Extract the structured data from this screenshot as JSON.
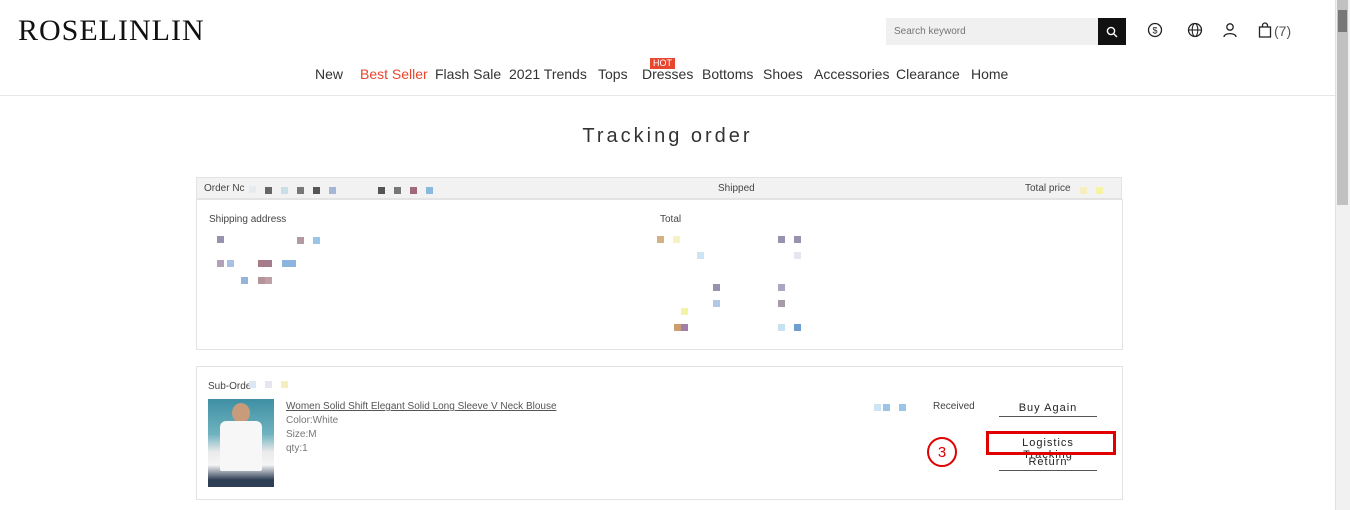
{
  "header": {
    "logo": "ROSELINLIN",
    "search_placeholder": "Search keyword",
    "cart_count": "(7)"
  },
  "nav": {
    "items": [
      "New",
      "Best Seller",
      "Flash Sale",
      "2021 Trends",
      "Tops",
      "Dresses",
      "Bottoms",
      "Shoes",
      "Accessories",
      "Clearance",
      "Home"
    ],
    "hot_badge": "HOT",
    "highlight_color": "#e8472f"
  },
  "page": {
    "title": "Tracking order"
  },
  "order": {
    "order_no_label": "Order Nc",
    "status": "Shipped",
    "total_price_label": "Total price",
    "shipping_address_label": "Shipping address",
    "total_label": "Total"
  },
  "sub_order": {
    "label": "Sub-Orde",
    "product_name": "Women Solid Shift Elegant Solid Long Sleeve V Neck Blouse",
    "color": "Color:White",
    "size": "Size:M",
    "qty": "qty:1",
    "status": "Received",
    "actions": {
      "buy_again": "Buy Again",
      "logistics_tracking": "Logistics Tracking",
      "return": "Return"
    }
  },
  "annotation": {
    "step_number": "3",
    "color": "#e00000"
  }
}
